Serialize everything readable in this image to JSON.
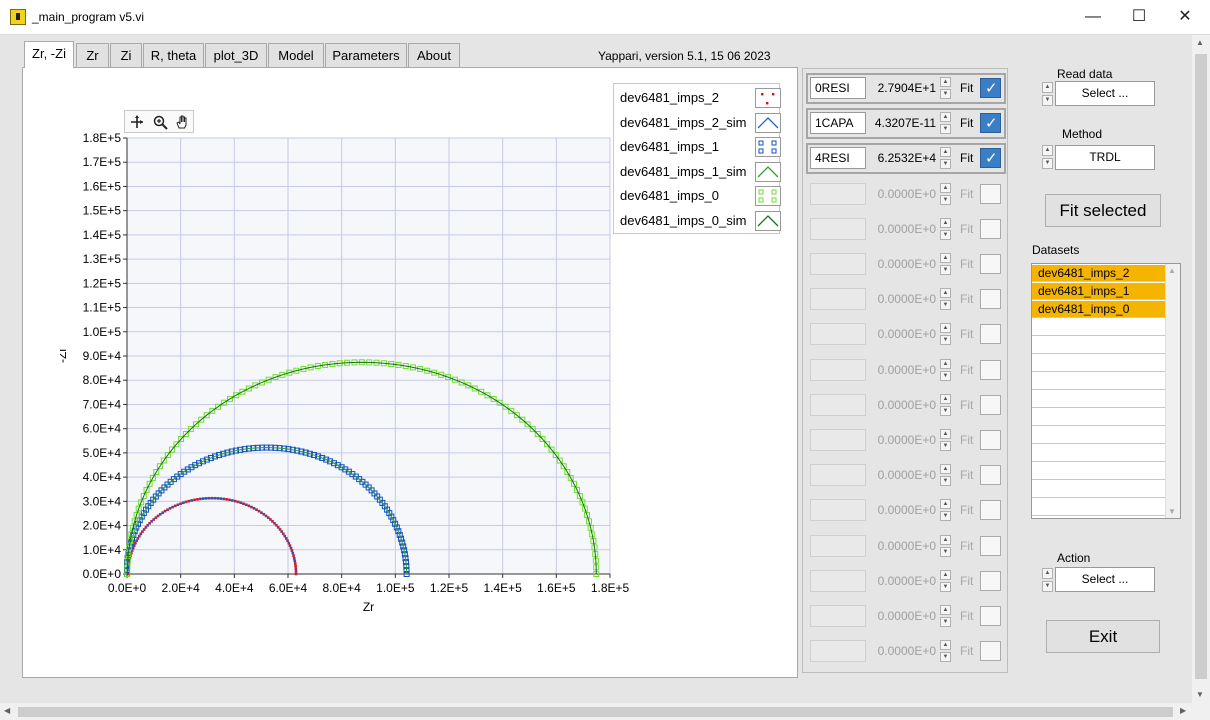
{
  "window": {
    "title": "_main_program v5.vi",
    "min_glyph": "—",
    "max_glyph": "☐",
    "close_glyph": "✕"
  },
  "tabs": [
    {
      "label": "Zr, -Zi",
      "active": true
    },
    {
      "label": "Zr",
      "active": false
    },
    {
      "label": "Zi",
      "active": false
    },
    {
      "label": "R, theta",
      "active": false
    },
    {
      "label": "plot_3D",
      "active": false
    },
    {
      "label": "Model",
      "active": false
    },
    {
      "label": "Parameters",
      "active": false
    },
    {
      "label": "About",
      "active": false
    }
  ],
  "version_text": "Yappari, version 5.1, 15 06 2023",
  "chart_data": {
    "type": "scatter",
    "xlabel": "Zr",
    "ylabel": "-Zi",
    "xlim": [
      0,
      180000
    ],
    "ylim": [
      0,
      180000
    ],
    "x_ticks": [
      "0.0E+0",
      "2.0E+4",
      "4.0E+4",
      "6.0E+4",
      "8.0E+4",
      "1.0E+5",
      "1.2E+5",
      "1.4E+5",
      "1.6E+5",
      "1.8E+5"
    ],
    "y_ticks": [
      "0.0E+0",
      "1.0E+4",
      "2.0E+4",
      "3.0E+4",
      "4.0E+4",
      "5.0E+4",
      "6.0E+4",
      "7.0E+4",
      "8.0E+4",
      "9.0E+4",
      "1.0E+5",
      "1.1E+5",
      "1.2E+5",
      "1.3E+5",
      "1.4E+5",
      "1.5E+5",
      "1.6E+5",
      "1.7E+5",
      "1.8E+5"
    ],
    "grid": true,
    "series": [
      {
        "name": "dev6481_imps_2",
        "color": "#e01010",
        "marker": "dot",
        "center_x": 31500,
        "radius": 31300,
        "offset_x": 200
      },
      {
        "name": "dev6481_imps_2_sim",
        "color": "#1f5fd0",
        "marker": "line",
        "center_x": 31500,
        "radius": 31300,
        "offset_x": 200
      },
      {
        "name": "dev6481_imps_1",
        "color": "#1050c0",
        "marker": "square",
        "center_x": 52000,
        "radius": 52200,
        "offset_x": 0
      },
      {
        "name": "dev6481_imps_1_sim",
        "color": "#2e9e2e",
        "marker": "line",
        "center_x": 52000,
        "radius": 52200,
        "offset_x": 0
      },
      {
        "name": "dev6481_imps_0",
        "color": "#6ee02a",
        "marker": "square",
        "center_x": 87500,
        "radius": 87400,
        "offset_x": 0
      },
      {
        "name": "dev6481_imps_0_sim",
        "color": "#1a6e1a",
        "marker": "line",
        "center_x": 87500,
        "radius": 87400,
        "offset_x": 0
      }
    ]
  },
  "legend": [
    {
      "name": "dev6481_imps_2",
      "icon": "red-dots-icon"
    },
    {
      "name": "dev6481_imps_2_sim",
      "icon": "blue-line-icon"
    },
    {
      "name": "dev6481_imps_1",
      "icon": "blue-squares-icon"
    },
    {
      "name": "dev6481_imps_1_sim",
      "icon": "green-line-icon"
    },
    {
      "name": "dev6481_imps_0",
      "icon": "green-squares-icon"
    },
    {
      "name": "dev6481_imps_0_sim",
      "icon": "dark-green-line-icon"
    }
  ],
  "palette_icons": [
    "cursor-move-icon",
    "zoom-icon",
    "pan-hand-icon"
  ],
  "params": [
    {
      "name": "0RESI",
      "value": "2.7904E+1",
      "fit_label": "Fit",
      "checked": true,
      "enabled": true
    },
    {
      "name": "1CAPA",
      "value": "4.3207E-11",
      "fit_label": "Fit",
      "checked": true,
      "enabled": true
    },
    {
      "name": "4RESI",
      "value": "6.2532E+4",
      "fit_label": "Fit",
      "checked": true,
      "enabled": true
    },
    {
      "name": "",
      "value": "0.0000E+0",
      "fit_label": "Fit",
      "checked": false,
      "enabled": false
    },
    {
      "name": "",
      "value": "0.0000E+0",
      "fit_label": "Fit",
      "checked": false,
      "enabled": false
    },
    {
      "name": "",
      "value": "0.0000E+0",
      "fit_label": "Fit",
      "checked": false,
      "enabled": false
    },
    {
      "name": "",
      "value": "0.0000E+0",
      "fit_label": "Fit",
      "checked": false,
      "enabled": false
    },
    {
      "name": "",
      "value": "0.0000E+0",
      "fit_label": "Fit",
      "checked": false,
      "enabled": false
    },
    {
      "name": "",
      "value": "0.0000E+0",
      "fit_label": "Fit",
      "checked": false,
      "enabled": false
    },
    {
      "name": "",
      "value": "0.0000E+0",
      "fit_label": "Fit",
      "checked": false,
      "enabled": false
    },
    {
      "name": "",
      "value": "0.0000E+0",
      "fit_label": "Fit",
      "checked": false,
      "enabled": false
    },
    {
      "name": "",
      "value": "0.0000E+0",
      "fit_label": "Fit",
      "checked": false,
      "enabled": false
    },
    {
      "name": "",
      "value": "0.0000E+0",
      "fit_label": "Fit",
      "checked": false,
      "enabled": false
    },
    {
      "name": "",
      "value": "0.0000E+0",
      "fit_label": "Fit",
      "checked": false,
      "enabled": false
    },
    {
      "name": "",
      "value": "0.0000E+0",
      "fit_label": "Fit",
      "checked": false,
      "enabled": false
    },
    {
      "name": "",
      "value": "0.0000E+0",
      "fit_label": "Fit",
      "checked": false,
      "enabled": false
    },
    {
      "name": "",
      "value": "0.0000E+0",
      "fit_label": "Fit",
      "checked": false,
      "enabled": false
    }
  ],
  "read_data": {
    "label": "Read data",
    "value": "Select ..."
  },
  "method": {
    "label": "Method",
    "value": "TRDL"
  },
  "fit_selected_label": "Fit selected",
  "datasets": {
    "label": "Datasets",
    "items": [
      "dev6481_imps_2",
      "dev6481_imps_1",
      "dev6481_imps_0"
    ],
    "empty_rows": 12
  },
  "action": {
    "label": "Action",
    "value": "Select ..."
  },
  "exit_label": "Exit"
}
